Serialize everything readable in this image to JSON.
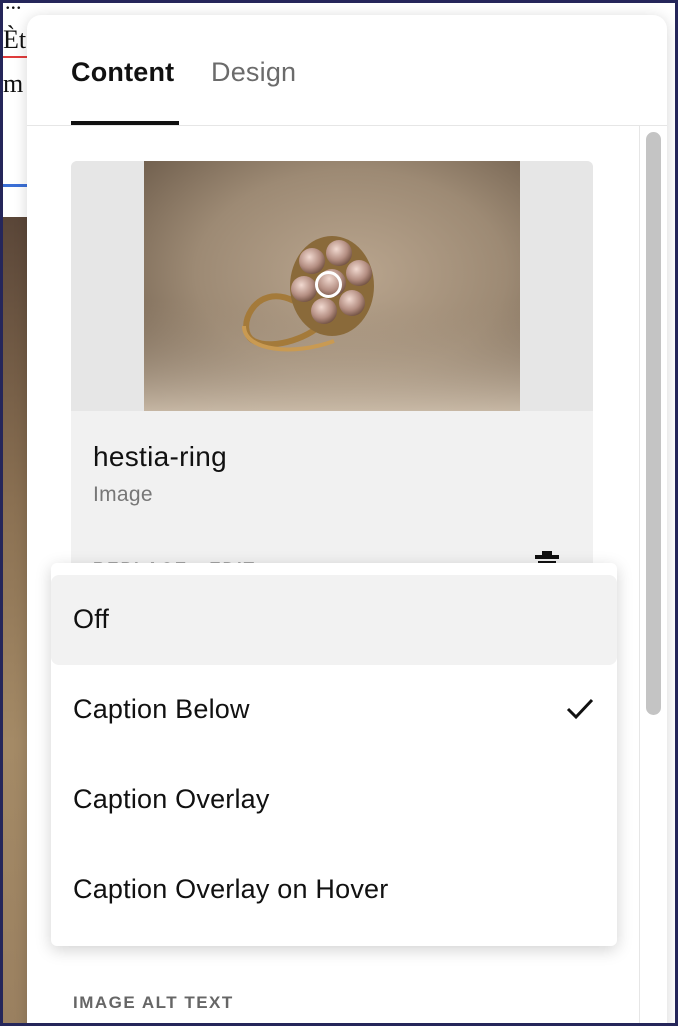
{
  "background_page": {
    "fragment_top": "...",
    "fragment_1": "Ète",
    "fragment_2": "m"
  },
  "tabs": [
    {
      "label": "Content",
      "active": true
    },
    {
      "label": "Design",
      "active": false
    }
  ],
  "image_card": {
    "title": "hestia-ring",
    "subtitle": "Image",
    "actions": "REPLACE · EDIT",
    "image_icon": "ring-photo"
  },
  "caption_menu": {
    "options": [
      {
        "label": "Off",
        "hovered": true,
        "selected": false
      },
      {
        "label": "Caption Below",
        "hovered": false,
        "selected": true
      },
      {
        "label": "Caption Overlay",
        "hovered": false,
        "selected": false
      },
      {
        "label": "Caption Overlay on Hover",
        "hovered": false,
        "selected": false
      }
    ]
  },
  "alt_text_label": "IMAGE ALT TEXT",
  "colors": {
    "accent_underline": "#111111",
    "hover_bg": "#f2f2f2"
  }
}
